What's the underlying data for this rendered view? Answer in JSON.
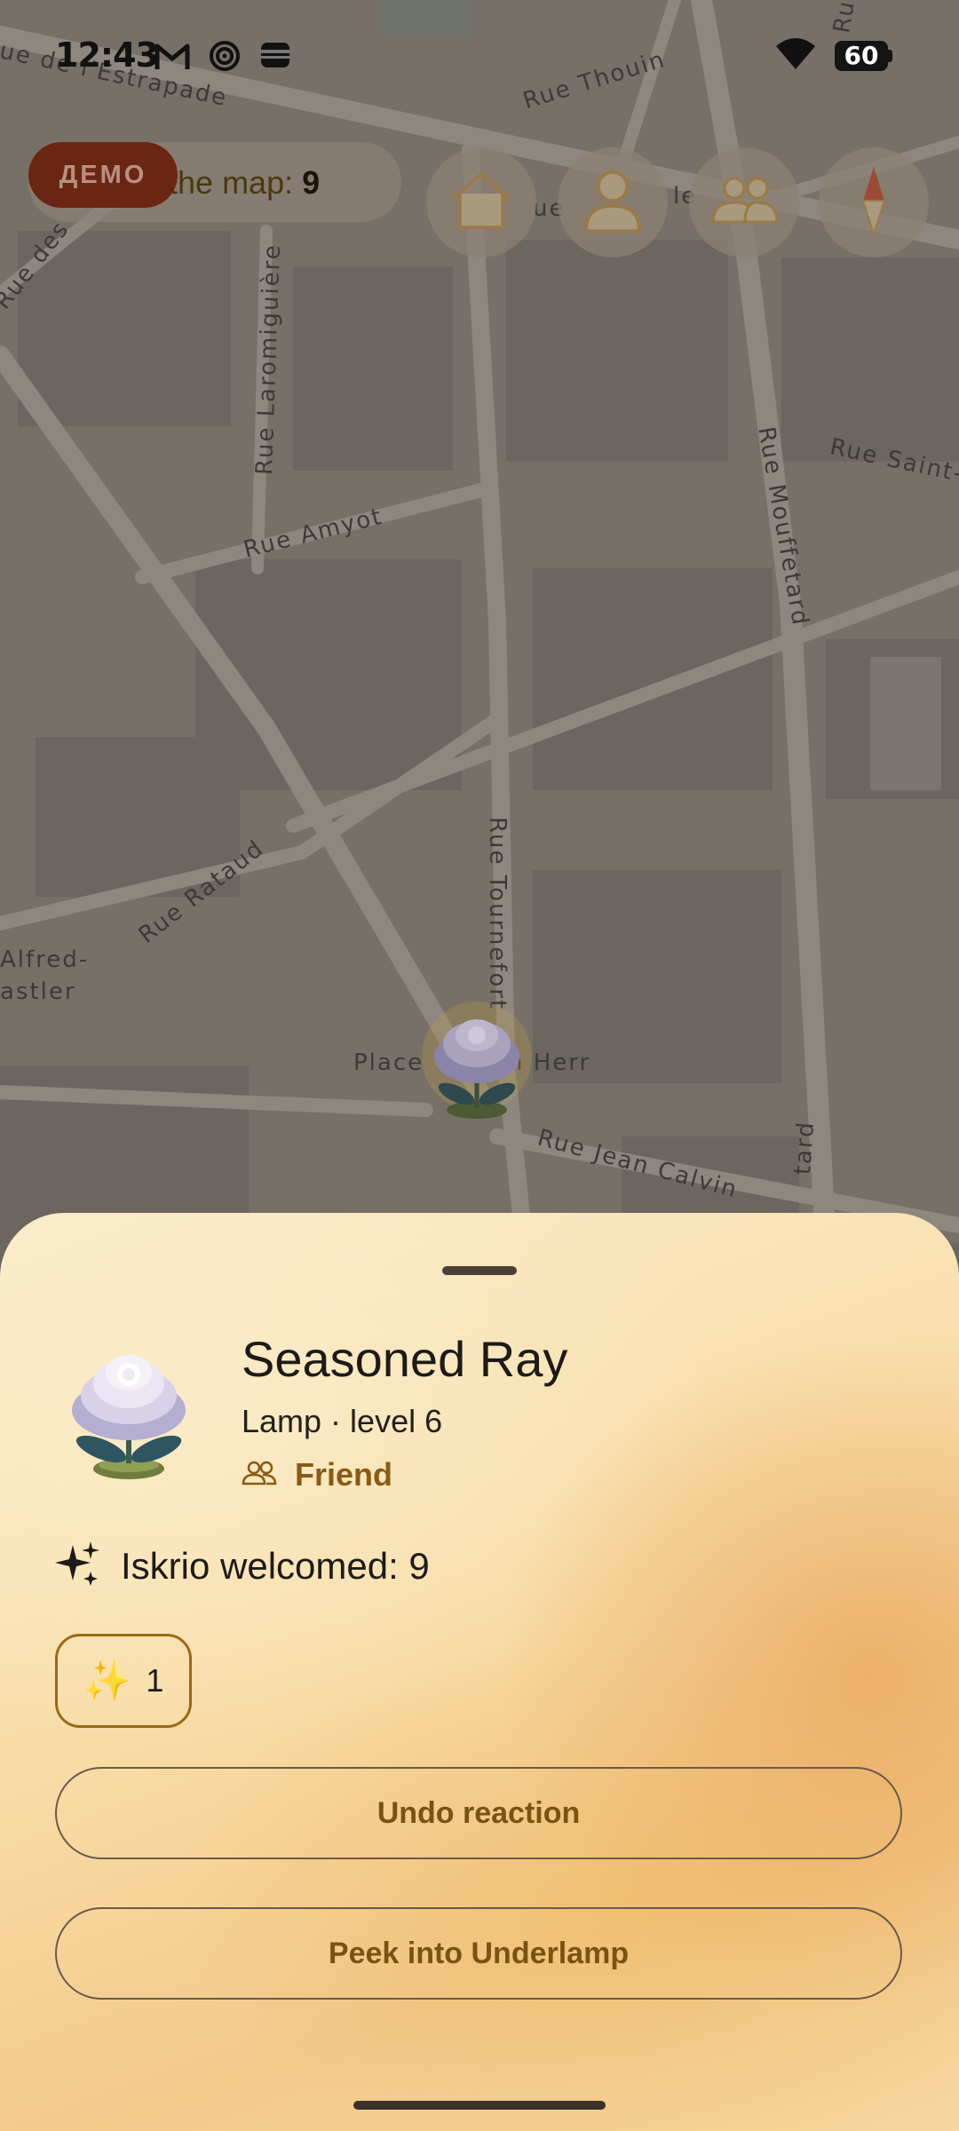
{
  "status_bar": {
    "time": "12:43",
    "battery": "60",
    "icons": [
      "gmail-icon",
      "sync-icon",
      "wallet-icon",
      "wifi-icon",
      "battery-icon"
    ]
  },
  "map": {
    "streets": [
      "ue de l'Estrapade",
      "Rue Thouin",
      "Rue des",
      "Rue Laromiguière",
      "Rue Amyot",
      "Rue Mouffetard",
      "Rue Saint-",
      "Rue Tournefort",
      "Rue Rataud",
      "Alfred-",
      "astler",
      "Place",
      "n Herr",
      "Rue Jean Calvin",
      "ue",
      "le",
      "tard",
      "Ru"
    ],
    "count_label": "n the map: ",
    "count_value": "9",
    "demo_badge": "ДЕМО",
    "buttons": [
      "home-icon",
      "profile-icon",
      "friends-icon",
      "compass-icon"
    ]
  },
  "sheet": {
    "name": "Seasoned Ray",
    "subtitle": "Lamp · level 6",
    "relation": "Friend",
    "welcomed": "Iskrio welcomed: 9",
    "reaction_emoji": "✨",
    "reaction_count": "1",
    "undo_label": "Undo reaction",
    "peek_label": "Peek into Underlamp"
  },
  "colors": {
    "accent": "#8a5a12",
    "demo_badge": "#6b2513",
    "sheet_background": "#f8dca6"
  }
}
